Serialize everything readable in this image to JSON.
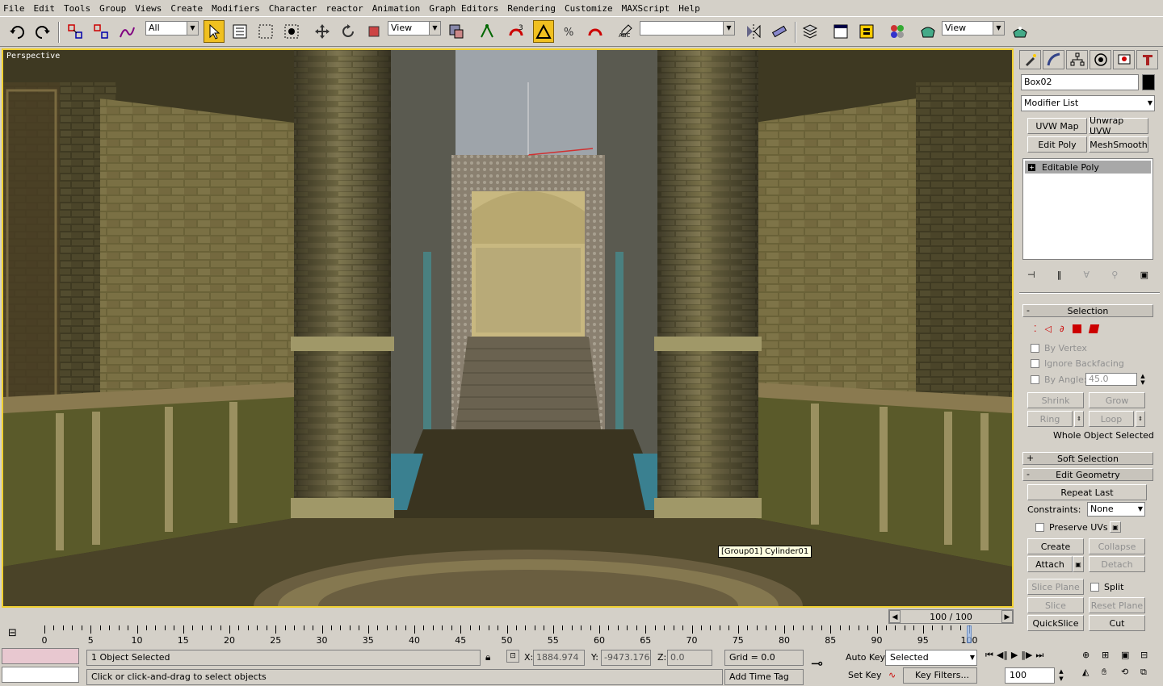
{
  "menu": [
    "File",
    "Edit",
    "Tools",
    "Group",
    "Views",
    "Create",
    "Modifiers",
    "Character",
    "reactor",
    "Animation",
    "Graph Editors",
    "Rendering",
    "Customize",
    "MAXScript",
    "Help"
  ],
  "toolbar": {
    "selection_filter": "All",
    "ref_coord_1": "View",
    "ref_coord_2": "View",
    "named_selection": "",
    "snap_label": "3"
  },
  "viewport": {
    "label": "Perspective",
    "tooltip": "[Group01] Cylinder01"
  },
  "command_panel": {
    "object_name": "Box02",
    "modifier_list": "Modifier List",
    "modifier_buttons": [
      "UVW Map",
      "Unwrap UVW",
      "Edit Poly",
      "MeshSmooth"
    ],
    "stack_item": "Editable Poly",
    "selection": {
      "title": "Selection",
      "by_vertex": "By Vertex",
      "ignore_backfacing": "Ignore Backfacing",
      "by_angle": "By Angle:",
      "angle_value": "45.0",
      "shrink": "Shrink",
      "grow": "Grow",
      "ring": "Ring",
      "loop": "Loop",
      "status": "Whole Object Selected"
    },
    "soft_selection": "Soft Selection",
    "edit_geometry": {
      "title": "Edit Geometry",
      "repeat_last": "Repeat Last",
      "constraints_label": "Constraints:",
      "constraints_value": "None",
      "preserve_uvs": "Preserve UVs",
      "create": "Create",
      "collapse": "Collapse",
      "attach": "Attach",
      "detach": "Detach",
      "slice_plane": "Slice Plane",
      "split": "Split",
      "slice": "Slice",
      "reset_plane": "Reset Plane",
      "quickslice": "QuickSlice",
      "cut": "Cut"
    }
  },
  "timeline": {
    "time_slider": "100 / 100",
    "ticks": [
      "0",
      "5",
      "10",
      "15",
      "20",
      "25",
      "30",
      "35",
      "40",
      "45",
      "50",
      "55",
      "60",
      "65",
      "70",
      "75",
      "80",
      "85",
      "90",
      "95",
      "100"
    ]
  },
  "status": {
    "selection_info": "1 Object Selected",
    "prompt": "Click or click-and-drag to select objects",
    "x_label": "X:",
    "x_value": "1884.974",
    "y_label": "Y:",
    "y_value": "-9473.176",
    "z_label": "Z:",
    "z_value": "0.0",
    "grid": "Grid = 0.0",
    "add_time_tag": "Add Time Tag",
    "auto_key": "Auto Key",
    "set_key": "Set Key",
    "selected_dropdown": "Selected",
    "key_filters": "Key Filters...",
    "frame_value": "100"
  },
  "colors": {
    "viewport_border": "#f0d030",
    "active_tool": "#f0c020",
    "panel_bg": "#d4d0c8"
  }
}
